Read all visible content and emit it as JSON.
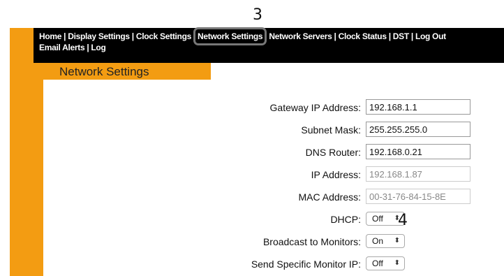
{
  "callouts": {
    "three": "3",
    "four": "4"
  },
  "nav": {
    "line1": [
      "Home",
      "Display Settings",
      "Clock Settings",
      "Network Settings",
      "Network Servers",
      "Clock Status",
      "DST",
      "Log Out"
    ],
    "line2": [
      "Email Alerts",
      "Log"
    ],
    "separator": "|",
    "active": "Network Settings"
  },
  "page_title": "Network Settings",
  "form": {
    "gateway": {
      "label": "Gateway IP Address:",
      "value": "192.168.1.1"
    },
    "subnet": {
      "label": "Subnet Mask:",
      "value": "255.255.255.0"
    },
    "dns": {
      "label": "DNS Router:",
      "value": "192.168.0.21"
    },
    "ip": {
      "label": "IP Address:",
      "value": "192.168.1.87"
    },
    "mac": {
      "label": "MAC Address:",
      "value": "00-31-76-84-15-8E"
    },
    "dhcp": {
      "label": "DHCP:",
      "value": "Off"
    },
    "broadcast": {
      "label": "Broadcast to Monitors:",
      "value": "On"
    },
    "specific_ip": {
      "label": "Send Specific Monitor IP:",
      "value": "Off"
    }
  },
  "icons": {
    "select_arrows": "⬍"
  },
  "colors": {
    "accent": "#f39c12",
    "navbar": "#000000"
  }
}
